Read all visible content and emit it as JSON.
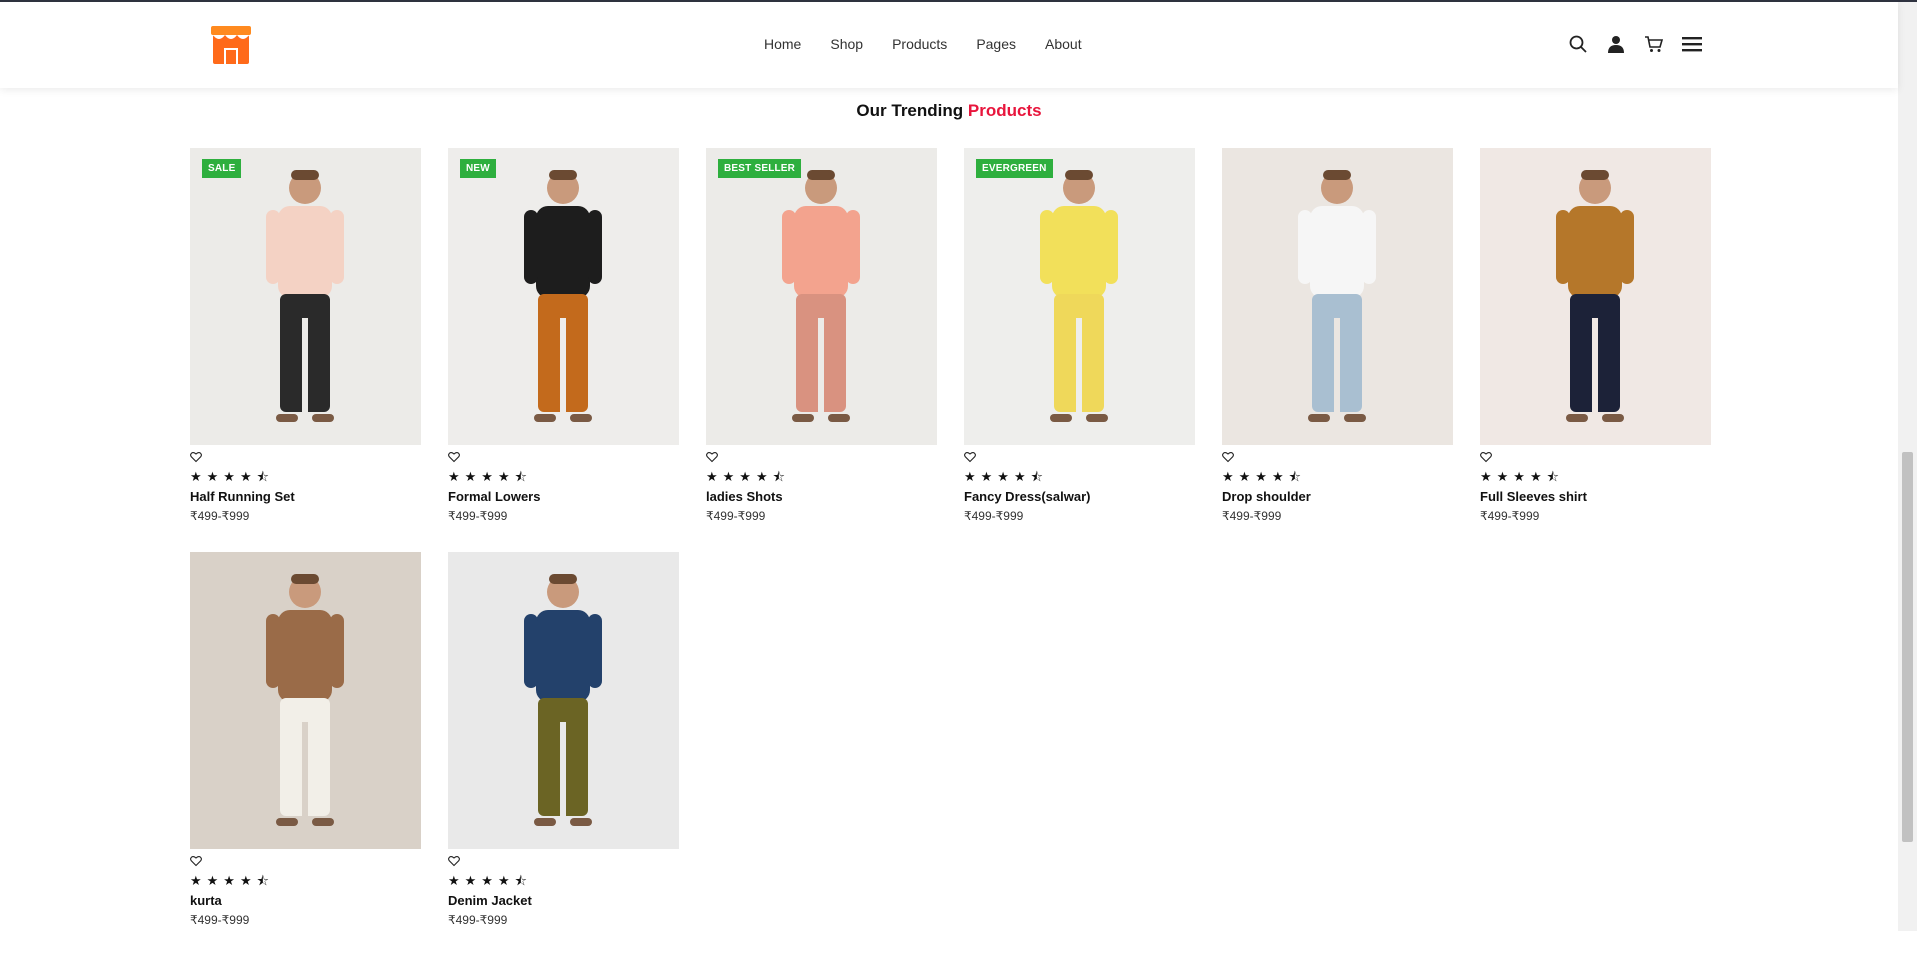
{
  "nav": {
    "logo_name": "store-logo",
    "links": [
      "Home",
      "Shop",
      "Products",
      "Pages",
      "About"
    ],
    "icons": [
      "search-icon",
      "user-icon",
      "cart-icon",
      "menu-icon"
    ]
  },
  "section": {
    "title_main": "Our Trending",
    "title_accent": "Products"
  },
  "products": [
    {
      "name": "Half Running Set",
      "price": "₹499-₹999",
      "badge": "SALE",
      "rating": "★★★★⯪",
      "bg": "#ecebe8",
      "top": "#f4d2c4",
      "bottom": "#2a2a2a"
    },
    {
      "name": "Formal Lowers",
      "price": "₹499-₹999",
      "badge": "NEW",
      "rating": "★★★★⯪",
      "bg": "#eeedeb",
      "top": "#1d1d1d",
      "bottom": "#c36a1c"
    },
    {
      "name": "ladies Shots",
      "price": "₹499-₹999",
      "badge": "BEST SELLER",
      "rating": "★★★★⯪",
      "bg": "#ecebe8",
      "top": "#f3a38e",
      "bottom": "#d99280"
    },
    {
      "name": "Fancy Dress(salwar)",
      "price": "₹499-₹999",
      "badge": "EVERGREEN",
      "rating": "★★★★⯪",
      "bg": "#eeeeec",
      "top": "#f2e05a",
      "bottom": "#efd85a"
    },
    {
      "name": "Drop shoulder",
      "price": "₹499-₹999",
      "badge": "",
      "rating": "★★★★⯪",
      "bg": "#ebe6e1",
      "top": "#f6f6f6",
      "bottom": "#a9bfd1"
    },
    {
      "name": "Full Sleeves shirt",
      "price": "₹499-₹999",
      "badge": "",
      "rating": "★★★★⯪",
      "bg": "#f0e8e4",
      "top": "#b5772a",
      "bottom": "#1c2238"
    },
    {
      "name": "kurta",
      "price": "₹499-₹999",
      "badge": "",
      "rating": "★★★★⯪",
      "bg": "#d9d1c8",
      "top": "#9a6b48",
      "bottom": "#f2efe8"
    },
    {
      "name": "Denim Jacket",
      "price": "₹499-₹999",
      "badge": "",
      "rating": "★★★★⯪",
      "bg": "#e9e9e9",
      "top": "#23416b",
      "bottom": "#6b6424"
    }
  ]
}
